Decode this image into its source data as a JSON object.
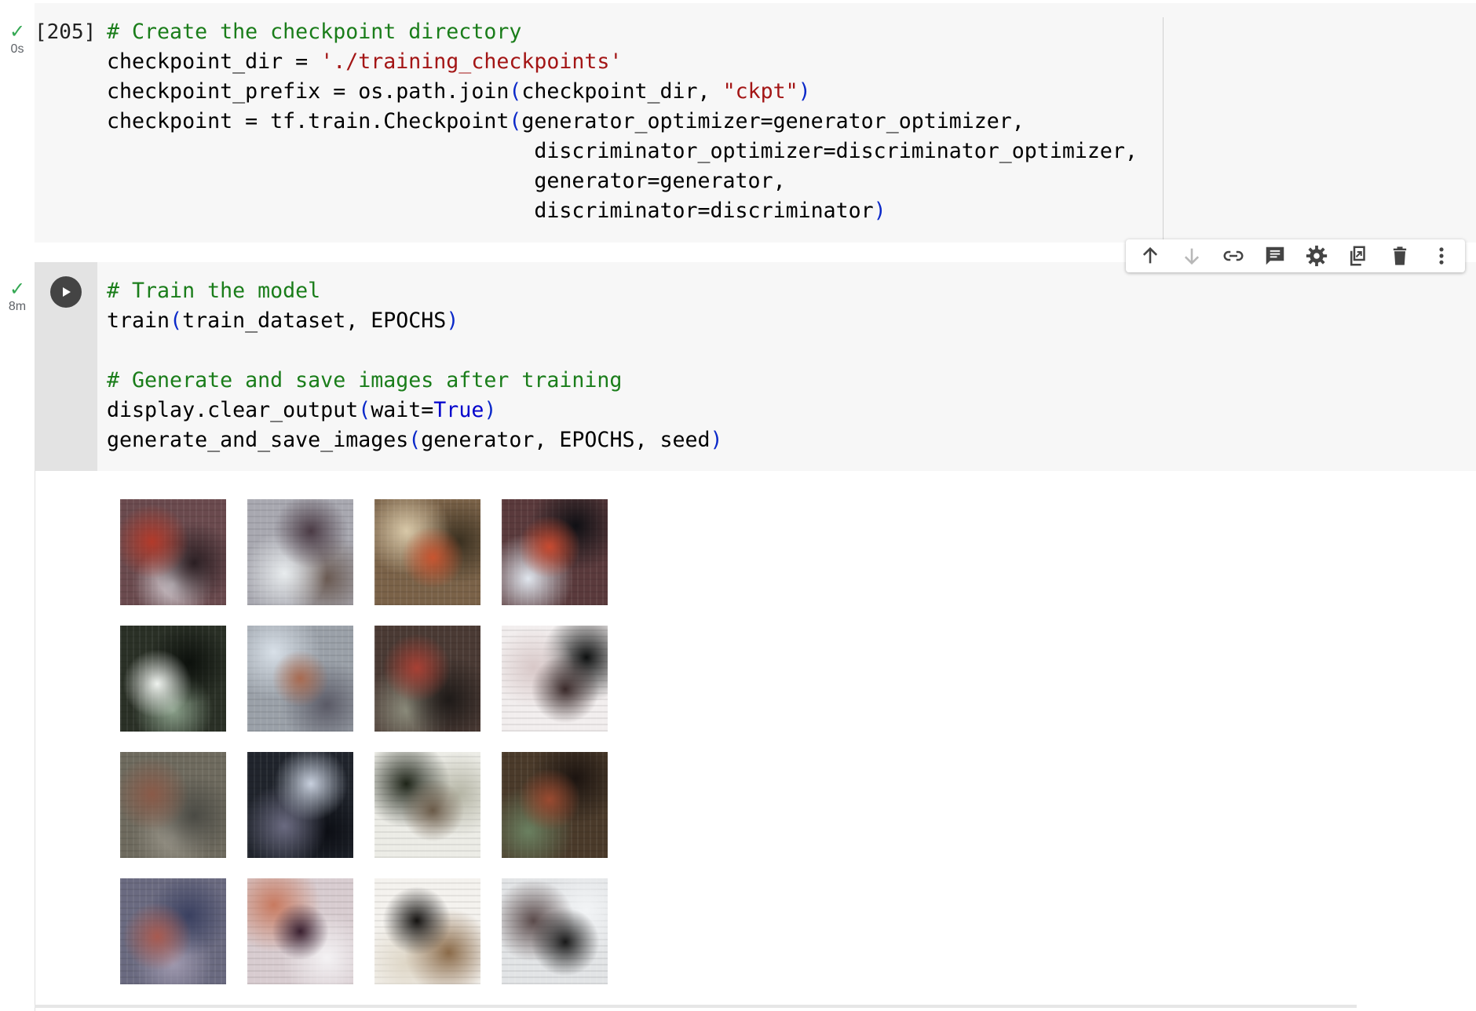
{
  "colors": {
    "cell_bg": "#f7f7f7",
    "comment": "#1a7d1a",
    "string": "#a31515",
    "keyword": "#0000cc",
    "bracket": "#0b29c9",
    "check": "#34a853"
  },
  "cell1": {
    "status_icon": "check-icon",
    "duration": "0s",
    "execution_count": "[205]",
    "lines": {
      "l1_comment": "# Create the checkpoint directory",
      "l2_a": "checkpoint_dir = ",
      "l2_str": "'./training_checkpoints'",
      "l3_a": "checkpoint_prefix = os.path.join",
      "l3_open": "(",
      "l3_b": "checkpoint_dir, ",
      "l3_str": "\"ckpt\"",
      "l3_close": ")",
      "l4_a": "checkpoint = tf.train.Checkpoint",
      "l4_open": "(",
      "l4_b": "generator_optimizer=generator_optimizer,",
      "l5": "discriminator_optimizer=discriminator_optimizer,",
      "l6": "generator=generator,",
      "l7_a": "discriminator=discriminator",
      "l7_close": ")"
    }
  },
  "cell2": {
    "status_icon": "check-icon",
    "duration": "8m",
    "run_icon": "play-icon",
    "lines": {
      "l1_comment": "# Train the model",
      "l2_a": "train",
      "l2_open": "(",
      "l2_b": "train_dataset, EPOCHS",
      "l2_close": ")",
      "l4_comment": "# Generate and save images after training",
      "l5_a": "display.clear_output",
      "l5_open": "(",
      "l5_b": "wait=",
      "l5_kw": "True",
      "l5_close": ")",
      "l6_a": "generate_and_save_images",
      "l6_open": "(",
      "l6_b": "generator, EPOCHS, seed",
      "l6_close": ")"
    }
  },
  "toolbar": {
    "icons": [
      "arrow-up-icon",
      "arrow-down-icon",
      "link-icon",
      "comment-icon",
      "gear-icon",
      "mirror-cell-icon",
      "trash-icon",
      "more-vert-icon"
    ]
  },
  "output": {
    "grid_rows": 4,
    "grid_cols": 4,
    "image_count": 16,
    "tiles": [
      {
        "bg": "#6a4a4e",
        "c1": "#b33a2a",
        "c2": "#2a1e22",
        "c3": "#d8d2d8"
      },
      {
        "bg": "#a8a8b0",
        "c1": "#4a3a44",
        "c2": "#e8ecee",
        "c3": "#6a5a52"
      },
      {
        "bg": "#7a6248",
        "c1": "#c85530",
        "c2": "#d8c8a8",
        "c3": "#3a3020"
      },
      {
        "bg": "#5a3a3c",
        "c1": "#c84a30",
        "c2": "#101014",
        "c3": "#e0e6ee"
      },
      {
        "bg": "#2a3026",
        "c1": "#eef2ee",
        "c2": "#0c100c",
        "c3": "#8aa08a"
      },
      {
        "bg": "#9aa0a8",
        "c1": "#a86a50",
        "c2": "#d8e0e8",
        "c3": "#5a5a66"
      },
      {
        "bg": "#4a3a34",
        "c1": "#a84034",
        "c2": "#1e1a18",
        "c3": "#8a8a7a"
      },
      {
        "bg": "#f2eeee",
        "c1": "#3a2a2a",
        "c2": "#d8c8c8",
        "c3": "#0e1010"
      },
      {
        "bg": "#6e6a5e",
        "c1": "#8a5a48",
        "c2": "#4a4a44",
        "c3": "#9a968a"
      },
      {
        "bg": "#20242c",
        "c1": "#c8d0de",
        "c2": "#6a6a80",
        "c3": "#0c0e14"
      },
      {
        "bg": "#ecece6",
        "c1": "#6a5a48",
        "c2": "#1e2418",
        "c3": "#b4b4a4"
      },
      {
        "bg": "#4a3a2a",
        "c1": "#9a4a30",
        "c2": "#1c1410",
        "c3": "#6a8060"
      },
      {
        "bg": "#6a6a80",
        "c1": "#a85a50",
        "c2": "#3a4060",
        "c3": "#a09ab0"
      },
      {
        "bg": "#d8ccd0",
        "c1": "#3a2030",
        "c2": "#c87a60",
        "c3": "#f4f2f4"
      },
      {
        "bg": "#f4f2ee",
        "c1": "#141210",
        "c2": "#8a6a48",
        "c3": "#ded6c6"
      },
      {
        "bg": "#e2e4e6",
        "c1": "#181818",
        "c2": "#5a4a4a",
        "c3": "#f2f4f6"
      }
    ]
  }
}
